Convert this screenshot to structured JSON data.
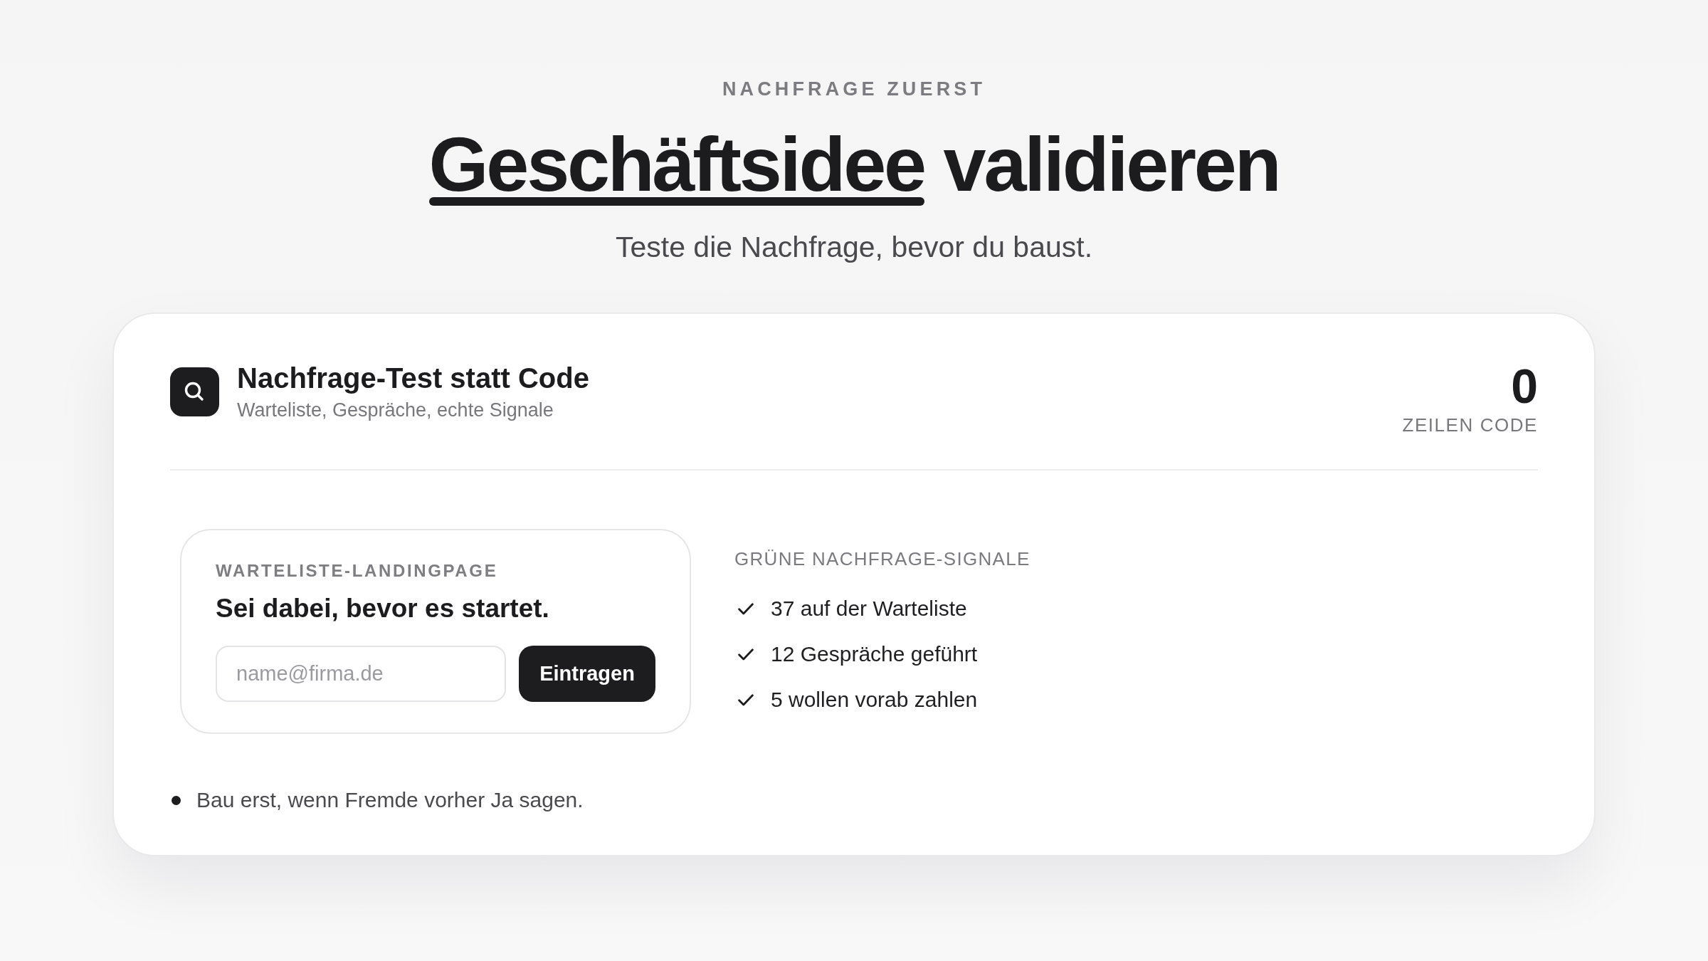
{
  "eyebrow": "NACHFRAGE ZUERST",
  "headline": {
    "parts": [
      {
        "text": "Geschäftsidee",
        "underlined": true
      },
      {
        "text": "validieren",
        "underlined": false
      }
    ]
  },
  "subtitle": "Teste die Nachfrage, bevor du baust.",
  "card": {
    "title": "Nachfrage-Test statt Code",
    "subtitle": "Warteliste, Gespräche, echte Signale",
    "stat": {
      "value": "0",
      "label": "ZEILEN CODE"
    },
    "landing_preview": {
      "label": "WARTELISTE-LANDINGPAGE",
      "heading": "Sei dabei, bevor es startet.",
      "email_field": {
        "placeholder": "name@firma.de"
      },
      "button": "Eintragen"
    },
    "signals": {
      "title": "GRÜNE NACHFRAGE-SIGNALE",
      "items": [
        "37 auf der Warteliste",
        "12 Gespräche geführt",
        "5 wollen vorab zahlen"
      ]
    },
    "note": "Bau erst, wenn Fremde vorher Ja sagen."
  }
}
